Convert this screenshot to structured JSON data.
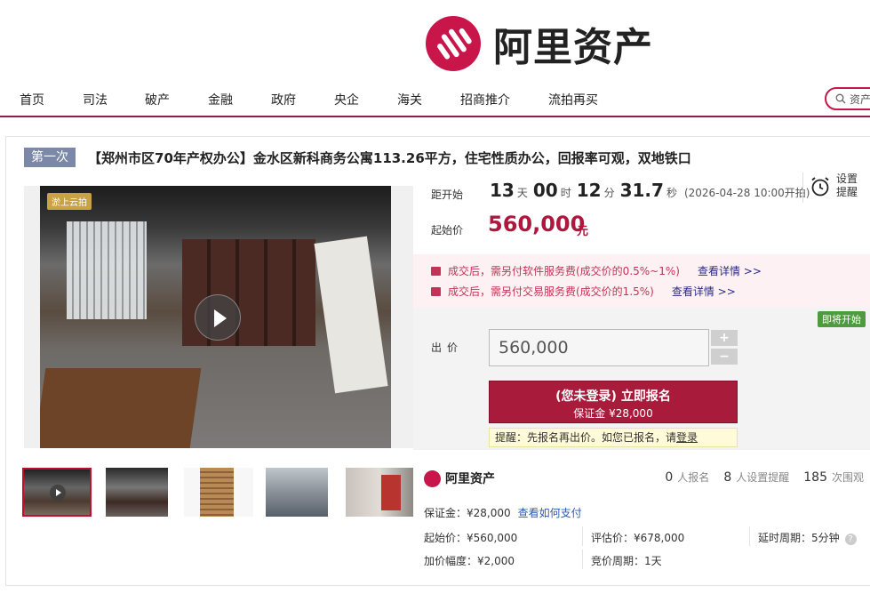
{
  "brand": {
    "name": "阿里资产",
    "color": "#c8164b"
  },
  "nav": {
    "items": [
      "首页",
      "司法",
      "破产",
      "金融",
      "政府",
      "央企",
      "海关",
      "招商推介",
      "流拍再买"
    ],
    "search_placeholder": "资产"
  },
  "listing": {
    "round": "第一次",
    "title": "【郑州市区70年产权办公】金水区新科商务公寓113.26平方，住宅性质办公，回报率可观，双地铁口",
    "photo_watermark": "淤上云拍",
    "countdown": {
      "label": "距开始",
      "days": "13",
      "days_unit": "天",
      "hours": "00",
      "hours_unit": "时",
      "minutes": "12",
      "minutes_unit": "分",
      "seconds": "31.7",
      "seconds_unit": "秒",
      "start_text": "(2026-04-28 10:00开拍)"
    },
    "remind": {
      "line1": "设置",
      "line2": "提醒"
    },
    "start_price_label": "起始价",
    "start_price": "560,000",
    "currency": "元",
    "fees": [
      {
        "text": "成交后，需另付软件服务费(成交价的0.5%~1%)",
        "link": "查看详情 >>"
      },
      {
        "text": "成交后，需另付交易服务费(成交价的1.5%)",
        "link": "查看详情 >>"
      }
    ],
    "bid": {
      "status_badge": "即将开始",
      "label": "出价",
      "value": "560,000",
      "plus": "+",
      "minus": "−",
      "signup_main": "(您未登录) 立即报名",
      "signup_sub": "保证金 ¥28,000",
      "tip_prefix": "提醒：先报名再出价。如您已报名，请",
      "tip_login": "登录"
    },
    "info": {
      "brand": "阿里资产",
      "signups": "0",
      "signups_unit": "人报名",
      "reminders": "8",
      "reminders_unit": "人设置提醒",
      "views": "185",
      "views_unit": "次围观",
      "deposit": "保证金：¥28,000",
      "deposit_link": "查看如何支付",
      "start_price": "起始价：¥560,000",
      "appraisal": "评估价：¥678,000",
      "delay": "延时周期：5分钟",
      "increment": "加价幅度：¥2,000",
      "cycle": "竞价周期：1天"
    }
  }
}
